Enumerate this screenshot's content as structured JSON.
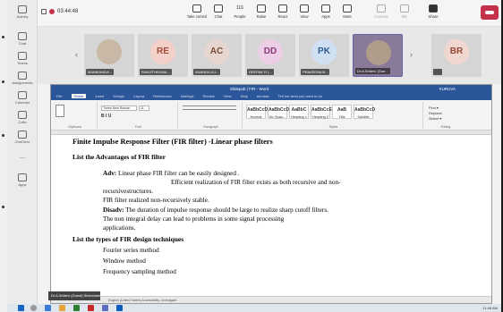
{
  "meeting": {
    "timer": "03:44:48",
    "controls": [
      {
        "label": "Take control",
        "icon": "take-control-icon"
      },
      {
        "label": "Chat",
        "icon": "chat-icon"
      },
      {
        "label": "People",
        "icon": "people-icon",
        "badge": "116"
      },
      {
        "label": "Raise",
        "icon": "raise-hand-icon"
      },
      {
        "label": "React",
        "icon": "react-icon"
      },
      {
        "label": "View",
        "icon": "view-icon"
      },
      {
        "label": "Apps",
        "icon": "apps-icon"
      },
      {
        "label": "More",
        "icon": "more-icon"
      },
      {
        "label": "Camera",
        "icon": "camera-icon"
      },
      {
        "label": "Mic",
        "icon": "mic-icon"
      },
      {
        "label": "Share",
        "icon": "share-icon"
      }
    ]
  },
  "rail": [
    {
      "label": "Activity",
      "icon": "bell-icon"
    },
    {
      "label": "Chat",
      "icon": "chat-icon"
    },
    {
      "label": "Teams",
      "icon": "teams-icon"
    },
    {
      "label": "Assignments",
      "icon": "assignments-icon"
    },
    {
      "label": "Calendar",
      "icon": "calendar-icon"
    },
    {
      "label": "Calls",
      "icon": "phone-icon"
    },
    {
      "label": "OneDrive",
      "icon": "cloud-icon"
    },
    {
      "label": "...",
      "icon": "more-icon"
    },
    {
      "label": "Apps",
      "icon": "apps-icon"
    }
  ],
  "participants": [
    {
      "name": "MANIKANDA...",
      "initials": "",
      "photo": true,
      "color": "#c9b8a5"
    },
    {
      "name": "RANJITHKUMA...",
      "initials": "RE",
      "color": "#f3d1c9",
      "text": "#a34a3a"
    },
    {
      "name": "ANANDA KU...",
      "initials": "AC",
      "color": "#e7d6cf",
      "text": "#7a4c3a"
    },
    {
      "name": "DEEPAK R (...",
      "initials": "DD",
      "color": "#eccfe6",
      "text": "#8e3a7c"
    },
    {
      "name": "PRAVEENA B...",
      "initials": "PK",
      "color": "#cfe0f3",
      "text": "#2f5b8e"
    },
    {
      "name": "Dr.A.Srideví (Gue...",
      "initials": "",
      "photo": true,
      "color": "#8a7a9a"
    },
    {
      "name": "",
      "initials": "BR",
      "color": "#f0d8d0",
      "text": "#944a3a"
    }
  ],
  "word": {
    "title": "Slidepub | FIR - Word",
    "user": "KURUVA",
    "tabs": [
      "File",
      "Home",
      "Insert",
      "Design",
      "Layout",
      "References",
      "Mailings",
      "Review",
      "View",
      "Help",
      "Acrobat",
      "Tell me what you want to do"
    ],
    "active_tab": "Home",
    "font_name": "Times New Roman",
    "font_size": "11",
    "groups": [
      "Clipboard",
      "Font",
      "Paragraph",
      "Styles",
      "Editing"
    ],
    "styles": [
      "Normal",
      "No Spac...",
      "Heading 1",
      "Heading 2",
      "Title",
      "Subtitle"
    ],
    "status": "English (United States)   Accessibility: Investigate"
  },
  "document": {
    "heading": "Finite Impulse Response Filter (FIR filter) -Linear phase filters",
    "section1": "List the Advantages of FIR filter",
    "adv_label": "Adv:",
    "adv_line1": "Linear phase FIR filter can be easily designed .",
    "adv_line2": "Efficient realization of FIR filter exists as both recursive and non-",
    "adv_line3": "recursivestructures.",
    "adv_line4": "FIR filter realized non-recursively stable.",
    "disadv_label": "Disadv:",
    "disadv_line1": "The duration of impulse response should be large to realize sharp cutoff filters.",
    "disadv_line2": "The non integral delay can lead to problems in some signal processing",
    "disadv_line3": "applications.",
    "section2": "List the types of FIR design techniques",
    "tech1": "Fourier series method",
    "tech2": "Window method",
    "tech3": "Frequency sampling method"
  },
  "pip_name": "Dr.A.Sridevi (Guest) Slideshared",
  "clock": "11:48 AM"
}
